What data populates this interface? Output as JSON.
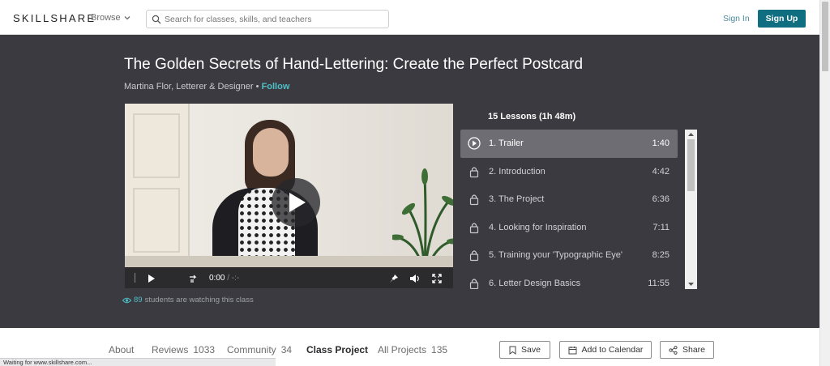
{
  "header": {
    "logo": "SKILLSHARE",
    "browse_label": "Browse",
    "search_placeholder": "Search for classes, skills, and teachers",
    "signin_label": "Sign In",
    "signup_label": "Sign Up"
  },
  "hero": {
    "title": "The Golden Secrets of Hand-Lettering: Create the Perfect Postcard",
    "author": "Martina Flor, Letterer & Designer",
    "bullet": "•",
    "follow_label": "Follow",
    "video": {
      "time_current": "0:00",
      "time_rest": "/ -:-",
      "progress_fraction": 0
    },
    "watching": {
      "count": "89",
      "text": "students are watching this class"
    }
  },
  "lessons": {
    "header": "15 Lessons (1h 48m)",
    "items": [
      {
        "name": "1. Trailer",
        "duration": "1:40",
        "active": true,
        "icon": "play-circle-icon"
      },
      {
        "name": "2. Introduction",
        "duration": "4:42",
        "active": false,
        "icon": "lock-icon"
      },
      {
        "name": "3. The Project",
        "duration": "6:36",
        "active": false,
        "icon": "lock-icon"
      },
      {
        "name": "4. Looking for Inspiration",
        "duration": "7:11",
        "active": false,
        "icon": "lock-icon"
      },
      {
        "name": "5. Training your 'Typographic Eye'",
        "duration": "8:25",
        "active": false,
        "icon": "lock-icon"
      },
      {
        "name": "6. Letter Design Basics",
        "duration": "11:55",
        "active": false,
        "icon": "lock-icon"
      }
    ]
  },
  "tabs": [
    {
      "label": "About",
      "count": ""
    },
    {
      "label": "Reviews",
      "count": "1033"
    },
    {
      "label": "Community",
      "count": "34"
    },
    {
      "label": "Class Project",
      "count": ""
    },
    {
      "label": "All Projects",
      "count": "135"
    }
  ],
  "actions": {
    "save_label": "Save",
    "calendar_label": "Add to Calendar",
    "share_label": "Share"
  },
  "status_text": "Waiting for www.skillshare.com...",
  "colors": {
    "accent": "#0f6e7f",
    "follow": "#4fc0c8",
    "hero_bg": "#3a3a40"
  }
}
